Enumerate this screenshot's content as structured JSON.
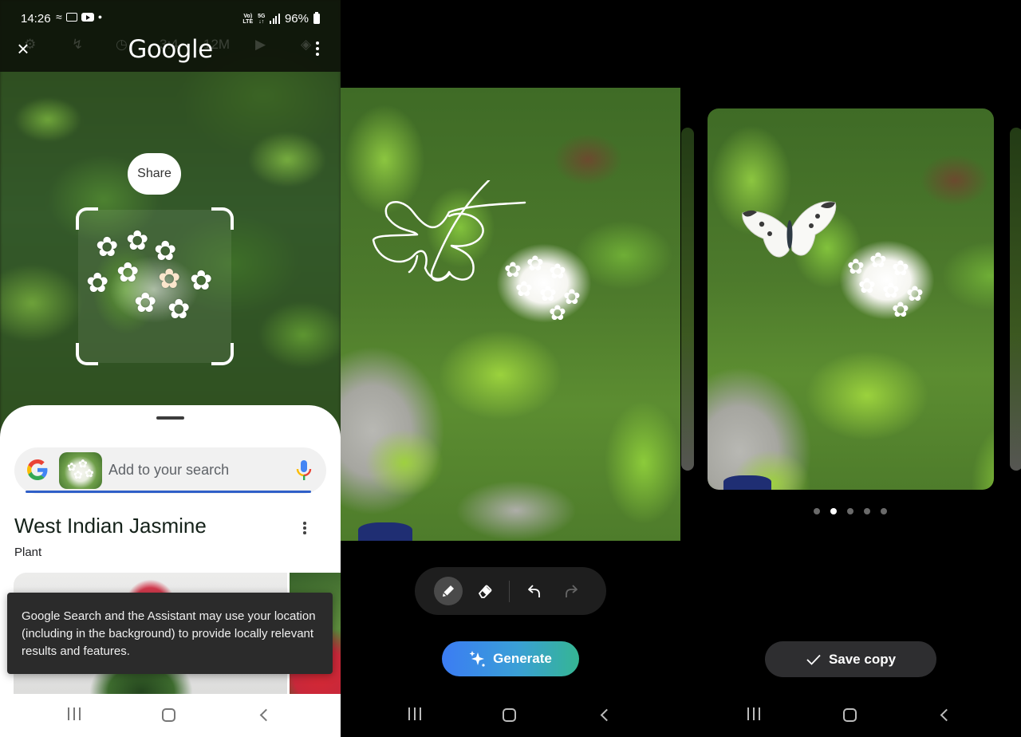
{
  "panel_lens": {
    "status_bar": {
      "time": "14:26",
      "net_label_1": "Vo) LTE",
      "net_label_2": "5G",
      "battery": "96%"
    },
    "header": {
      "title": "Google",
      "close_icon": "close-icon",
      "more_icon": "more-vert-icon",
      "ghost_controls": [
        "settings-icon",
        "flash-off-icon",
        "timer-icon",
        "3:4",
        "12M",
        "motion-photo-icon",
        "layers-icon"
      ]
    },
    "share_label": "Share",
    "search": {
      "placeholder": "Add to your search",
      "google_icon": "google-g-icon",
      "mic_icon": "mic-icon"
    },
    "result": {
      "title": "West Indian Jasmine",
      "subtitle": "Plant"
    },
    "toast": "Google Search and the Assistant may use your location (including in the background) to provide locally relevant results and features."
  },
  "panel_sketch": {
    "tools": [
      {
        "name": "pen",
        "icon": "pencil-icon",
        "active": true
      },
      {
        "name": "eraser",
        "icon": "eraser-icon",
        "active": false
      },
      {
        "name": "undo",
        "icon": "undo-icon",
        "active": false
      },
      {
        "name": "redo",
        "icon": "redo-icon",
        "active": false,
        "disabled": true
      }
    ],
    "generate_label": "Generate"
  },
  "panel_result": {
    "carousel": {
      "count": 5,
      "current": 2
    },
    "save_label": "Save copy"
  },
  "navigation": {
    "recents": "recents-icon",
    "home": "home-icon",
    "back": "back-icon"
  },
  "colors": {
    "accent_blue": "#2f5fc8",
    "generate_start": "#3b7cf4",
    "generate_end": "#35b693",
    "toast_bg": "#2b2b2b",
    "save_bg": "#2e2e30"
  }
}
